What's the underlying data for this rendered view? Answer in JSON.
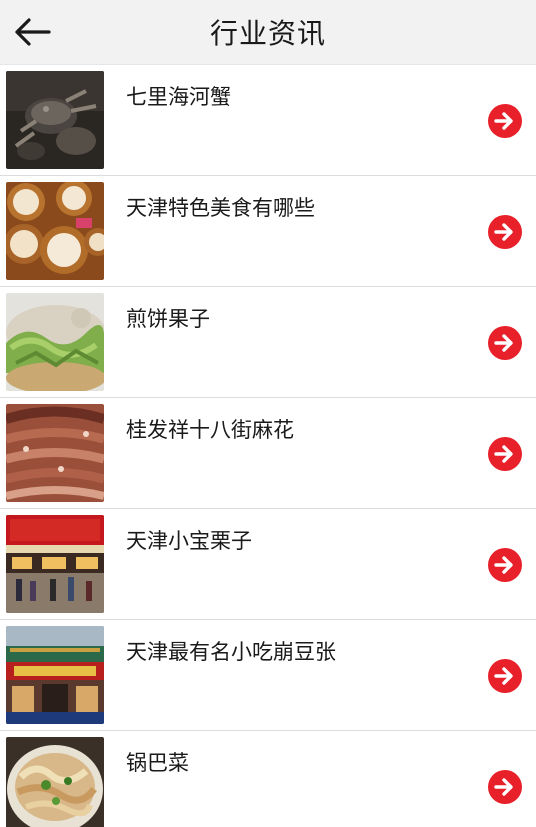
{
  "header": {
    "title": "行业资讯",
    "back_icon": "arrow-left-icon"
  },
  "colors": {
    "accent": "#e8202a",
    "header_bg": "#f2f2f2"
  },
  "items": [
    {
      "title": "七里海河蟹"
    },
    {
      "title": "天津特色美食有哪些"
    },
    {
      "title": "煎饼果子"
    },
    {
      "title": "桂发祥十八街麻花"
    },
    {
      "title": "天津小宝栗子"
    },
    {
      "title": "天津最有名小吃崩豆张"
    },
    {
      "title": "锅巴菜"
    }
  ]
}
